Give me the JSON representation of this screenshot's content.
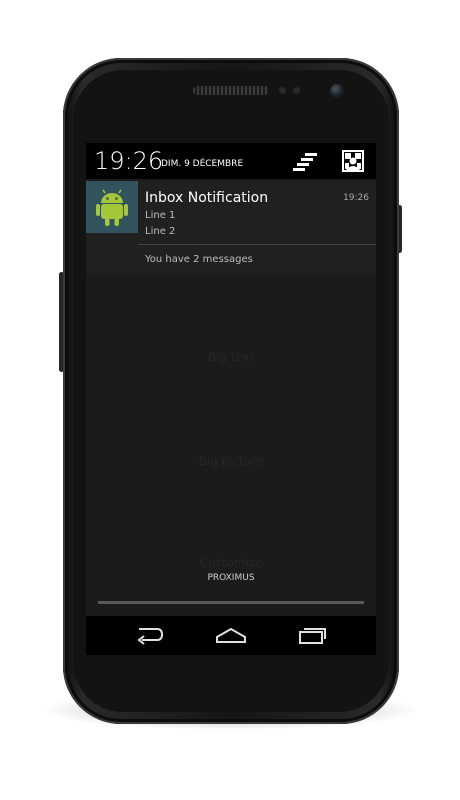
{
  "status_bar": {
    "time": "19:26",
    "date": "DIM. 9 DÉCEMBRE",
    "icons": [
      "quick-settings-icon",
      "user-profile-icon"
    ]
  },
  "notification": {
    "title": "Inbox Notification",
    "time": "19:26",
    "lines": [
      "Line 1",
      "Line 2"
    ],
    "summary": "You have 2 messages",
    "icon": "android-robot-icon"
  },
  "background_items": [
    "Big text",
    "Big picture",
    "Customize"
  ],
  "carrier": "PROXIMUS",
  "nav_bar": {
    "icons": [
      "back-icon",
      "home-icon",
      "recent-apps-icon"
    ]
  },
  "colors": {
    "screen_bg": "#1b1b1b",
    "notification_bg": "#202020",
    "notification_icon_bg": "#32535d",
    "android_green": "#a4c639"
  }
}
